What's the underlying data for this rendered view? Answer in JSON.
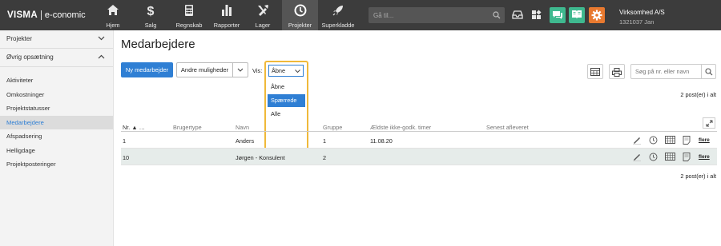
{
  "app": {
    "brand": "VISMA",
    "product": "e-conomic"
  },
  "nav": [
    {
      "label": "Hjem",
      "icon": "home-icon"
    },
    {
      "label": "Salg",
      "icon": "dollar-icon"
    },
    {
      "label": "Regnskab",
      "icon": "calculator-icon"
    },
    {
      "label": "Rapporter",
      "icon": "bar-chart-icon"
    },
    {
      "label": "Lager",
      "icon": "tools-icon"
    },
    {
      "label": "Projekter",
      "icon": "clock-icon",
      "active": true
    },
    {
      "label": "Superkladde",
      "icon": "rocket-icon"
    }
  ],
  "search": {
    "placeholder": "Gå til..."
  },
  "tools": {
    "inbox": "inbox-icon",
    "apps": "apps-icon",
    "chat": "chat-icon",
    "book": "book-icon",
    "settings": "gear-icon",
    "colors": {
      "chat": "#3fb98f",
      "book": "#3fb98f",
      "settings": "#e8792f"
    }
  },
  "company": {
    "name": "Virksomhed A/S",
    "sub": "1321037 Jan"
  },
  "sidebar": {
    "sections": [
      {
        "label": "Projekter",
        "expanded": false
      },
      {
        "label": "Øvrig opsætning",
        "expanded": true
      }
    ],
    "items": [
      {
        "label": "Aktiviteter"
      },
      {
        "label": "Omkostninger"
      },
      {
        "label": "Projektstatusser"
      },
      {
        "label": "Medarbejdere",
        "active": true
      },
      {
        "label": "Afspadsering"
      },
      {
        "label": "Helligdage"
      },
      {
        "label": "Projektposteringer"
      }
    ]
  },
  "main": {
    "title": "Medarbejdere",
    "new_button": "Ny medarbejder",
    "more_button": "Andre muligheder",
    "vis_label": "Vis:",
    "vis_select": {
      "value": "Åbne",
      "options": [
        "Åbne",
        "Spærrede",
        "Alle"
      ],
      "highlighted": "Spærrede"
    },
    "search_placeholder": "Søg på nr. eller navn",
    "count_top": "2 post(er) i alt",
    "count_bottom": "2 post(er) i alt",
    "columns": [
      "Nr. ▲ …",
      "Brugertype",
      "Navn",
      "Gruppe",
      "Ældste ikke-godk. timer",
      "Senest afleveret"
    ],
    "rows": [
      {
        "nr": "1",
        "brugertype": "",
        "navn": "Anders",
        "gruppe": "1",
        "aeldste": "11.08.20",
        "senest": "",
        "more": "flere"
      },
      {
        "nr": "10",
        "brugertype": "",
        "navn": "Jørgen - Konsulent",
        "gruppe": "2",
        "aeldste": "",
        "senest": "",
        "more": "flere"
      }
    ]
  },
  "colors": {
    "accent": "#2f7fd4",
    "topbar": "#3c3c3c",
    "highlight": "#f0b93a"
  }
}
